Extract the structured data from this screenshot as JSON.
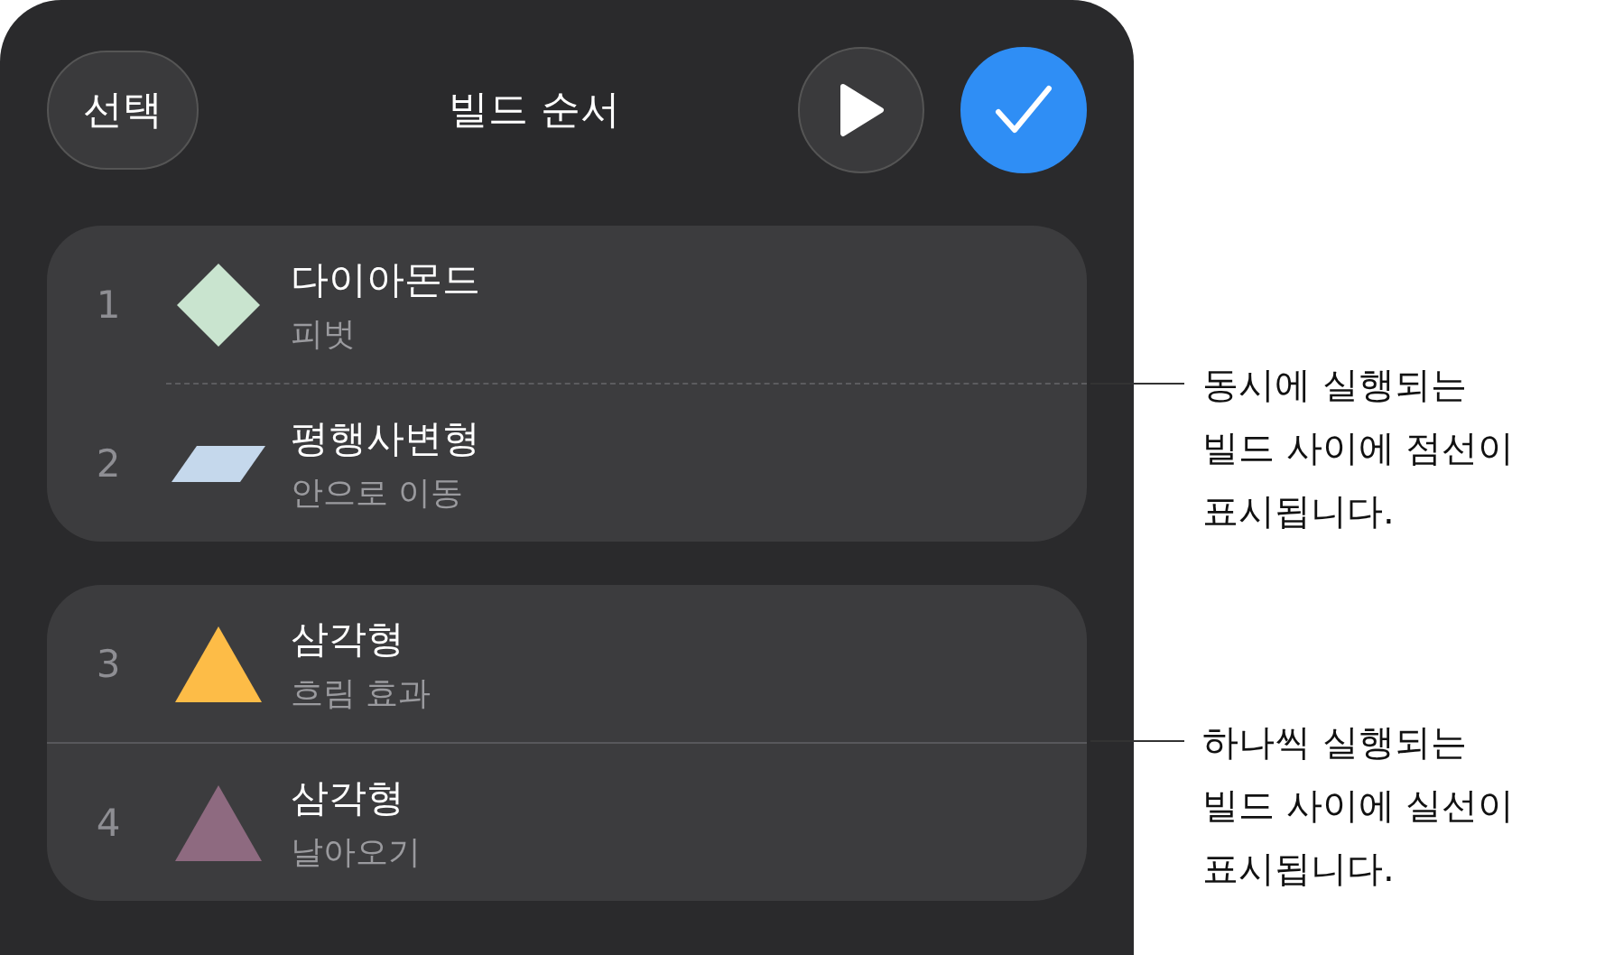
{
  "header": {
    "left_button": "선택",
    "title": "빌드 순서"
  },
  "groups": [
    {
      "dashed_divider": true,
      "items": [
        {
          "number": "1",
          "name": "다이아몬드",
          "effect": "피벗",
          "kind": "diamond",
          "color": "#c9e4cf"
        },
        {
          "number": "2",
          "name": "평행사변형",
          "effect": "안으로 이동",
          "kind": "parallelogram",
          "color": "#c5d8ec"
        }
      ]
    },
    {
      "dashed_divider": false,
      "items": [
        {
          "number": "3",
          "name": "삼각형",
          "effect": "흐림 효과",
          "kind": "triangle",
          "color": "#fdbc47"
        },
        {
          "number": "4",
          "name": "삼각형",
          "effect": "날아오기",
          "kind": "triangle",
          "color": "#8e6a80"
        }
      ]
    }
  ],
  "callouts": [
    {
      "lines": [
        "동시에 실행되는",
        "빌드 사이에 점선이",
        "표시됩니다."
      ]
    },
    {
      "lines": [
        "하나씩 실행되는",
        "빌드 사이에 실선이",
        "표시됩니다."
      ]
    }
  ]
}
